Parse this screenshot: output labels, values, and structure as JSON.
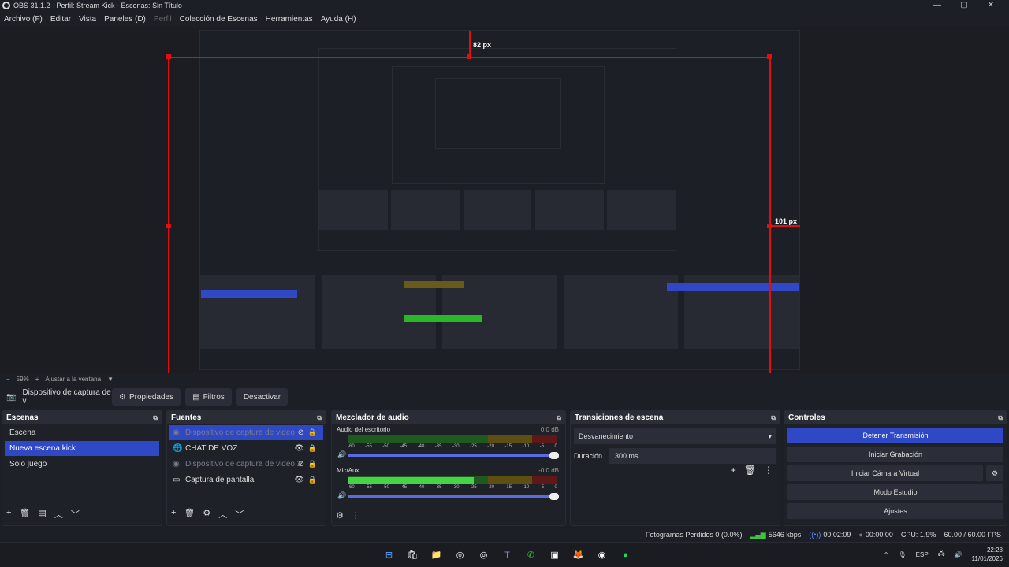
{
  "window": {
    "title": "OBS 31.1.2 - Perfil: Stream Kick - Escenas: Sin Título",
    "controls": [
      "—",
      "▢",
      "✕"
    ]
  },
  "menu": {
    "items": [
      "Archivo (F)",
      "Editar",
      "Vista",
      "Paneles (D)",
      "Perfil",
      "Colección de Escenas",
      "Herramientas",
      "Ayuda (H)"
    ]
  },
  "preview": {
    "label_top": "82 px",
    "label_right": "101 px",
    "zoom": "59%",
    "fit_label": "Ajustar a la ventana"
  },
  "toolbar": {
    "source_name": "Dispositivo de captura de v",
    "properties": "Propiedades",
    "filters": "Filtros",
    "deactivate": "Desactivar"
  },
  "scenes": {
    "title": "Escenas",
    "items": [
      "Escena",
      "Nueva escena kick",
      "Solo juego"
    ],
    "selected": 1
  },
  "sources": {
    "title": "Fuentes",
    "items": [
      {
        "name": "Dispositivo de captura de video",
        "icon": "camera-icon",
        "visible": false
      },
      {
        "name": "CHAT DE VOZ",
        "icon": "globe-icon",
        "visible": true
      },
      {
        "name": "Dispositivo de captura de video 2",
        "icon": "camera-icon",
        "visible": false
      },
      {
        "name": "Captura de pantalla",
        "icon": "monitor-icon",
        "visible": true
      }
    ]
  },
  "mixer": {
    "title": "Mezclador de audio",
    "tracks": [
      {
        "name": "Audio del escritorio",
        "db": "0.0 dB",
        "level": 0
      },
      {
        "name": "Mic/Aux",
        "db": "-0.0 dB",
        "level": 0.6
      }
    ],
    "scale": [
      "-60",
      "-55",
      "-50",
      "-45",
      "-40",
      "-35",
      "-30",
      "-25",
      "-20",
      "-15",
      "-10",
      "-5",
      "0"
    ]
  },
  "transitions": {
    "title": "Transiciones de escena",
    "selected": "Desvanecimiento",
    "duration_label": "Duración",
    "duration_value": "300 ms"
  },
  "controls": {
    "title": "Controles",
    "buttons": [
      "Detener Transmisión",
      "Iniciar Grabación",
      "Iniciar Cámara Virtual",
      "Modo Estudio",
      "Ajustes"
    ]
  },
  "status": {
    "dropped": "Fotogramas Perdidos 0 (0.0%)",
    "bitrate": "5646 kbps",
    "stream_time": "00:02:09",
    "rec_time": "00:00:00",
    "cpu": "CPU: 1.9%",
    "fps": "60.00 / 60.00 FPS"
  },
  "taskbar": {
    "icons": [
      "windows-icon",
      "store-icon",
      "folder-icon",
      "chrome-icon",
      "chrome-icon",
      "teams-icon",
      "whatsapp-icon",
      "photos-icon",
      "firefox-icon",
      "obs-icon",
      "spotify-icon"
    ],
    "lang": "ESP",
    "time": "22:28",
    "date": "11/01/2026"
  },
  "colors": {
    "accent": "#2f49c6",
    "meter_green": "#44d444",
    "guide_red": "#e01010"
  }
}
